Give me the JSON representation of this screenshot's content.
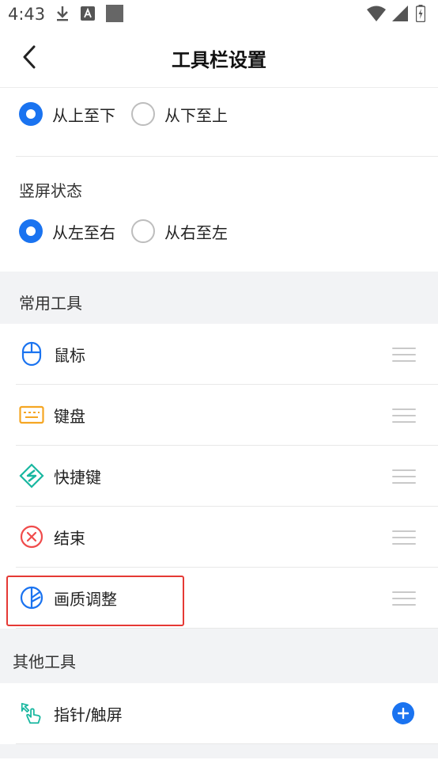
{
  "status_bar": {
    "time": "4:43",
    "left_icons": [
      "download-icon",
      "a-text-icon",
      "square-icon"
    ],
    "right_icons": [
      "wifi-icon",
      "signal-icon",
      "battery-icon"
    ]
  },
  "header": {
    "title": "工具栏设置",
    "back_icon": "chevron-left-icon"
  },
  "orientation": {
    "landscape_options": [
      {
        "label": "从上至下",
        "selected": true
      },
      {
        "label": "从下至上",
        "selected": false
      }
    ],
    "portrait_label": "竖屏状态",
    "portrait_options": [
      {
        "label": "从左至右",
        "selected": true
      },
      {
        "label": "从右至左",
        "selected": false
      }
    ]
  },
  "common_tools": {
    "label": "常用工具",
    "items": [
      {
        "label": "鼠标",
        "icon": "mouse-icon",
        "color": "#1a73f0"
      },
      {
        "label": "键盘",
        "icon": "keyboard-icon",
        "color": "#f5a623"
      },
      {
        "label": "快捷键",
        "icon": "shortcut-icon",
        "color": "#19b7a0"
      },
      {
        "label": "结束",
        "icon": "close-circle-icon",
        "color": "#f04b4b"
      },
      {
        "label": "画质调整",
        "icon": "quality-icon",
        "color": "#1a73f0"
      }
    ]
  },
  "other_tools": {
    "label": "其他工具",
    "items": [
      {
        "label": "指针/触屏",
        "icon": "touch-pointer-icon",
        "color": "#19b7a0"
      }
    ]
  },
  "colors": {
    "accent": "#1a73f0",
    "highlight": "#e53935"
  }
}
